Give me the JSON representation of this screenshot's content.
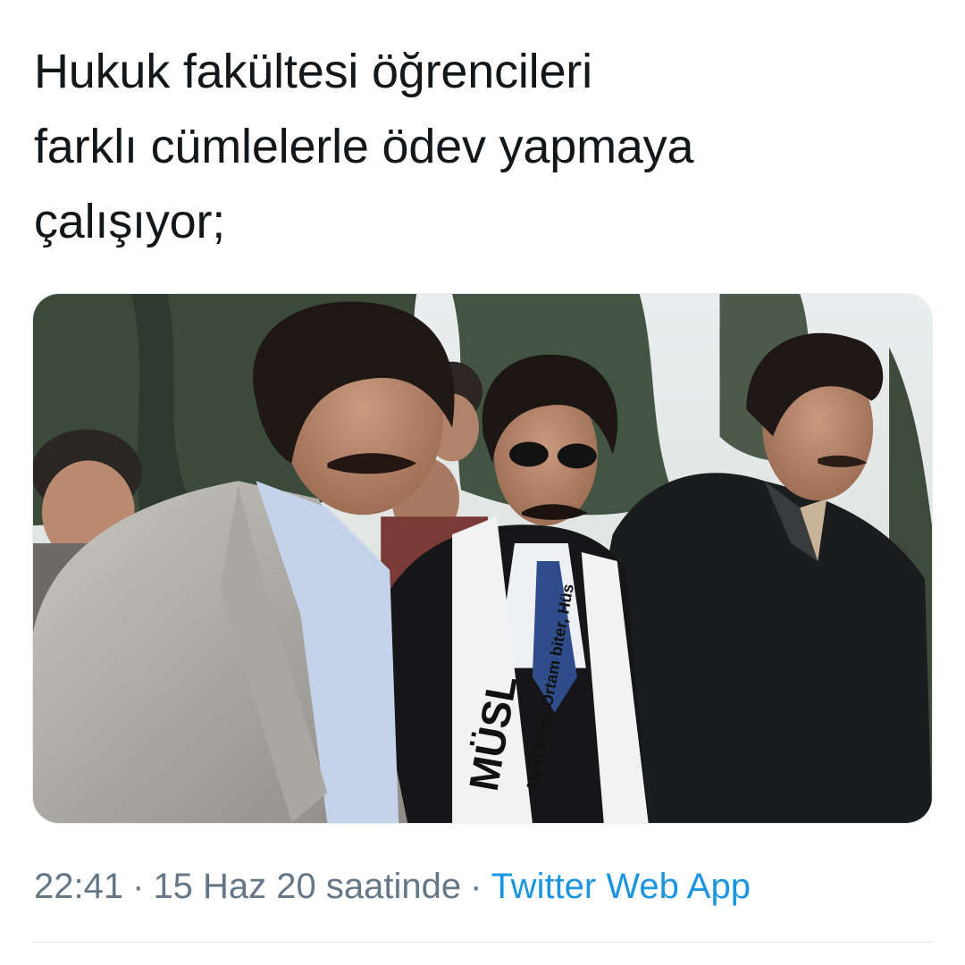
{
  "tweet": {
    "text_lines": [
      "Hukuk fakültesi öğrencileri",
      "farklı cümlelerle ödev yapmaya",
      "çalışıyor;"
    ]
  },
  "media": {
    "scarf_text_1": "MÜSL",
    "scarf_text_2": "Alem biter, Ortam biter, Hüs"
  },
  "meta": {
    "time": "22:41",
    "separator": "·",
    "date_text": "15 Haz 20 saatinde",
    "source": "Twitter Web App"
  },
  "colors": {
    "text": "#14171a",
    "meta_gray": "#657786",
    "link_blue": "#1b95e0",
    "divider": "#e1e8ed"
  }
}
